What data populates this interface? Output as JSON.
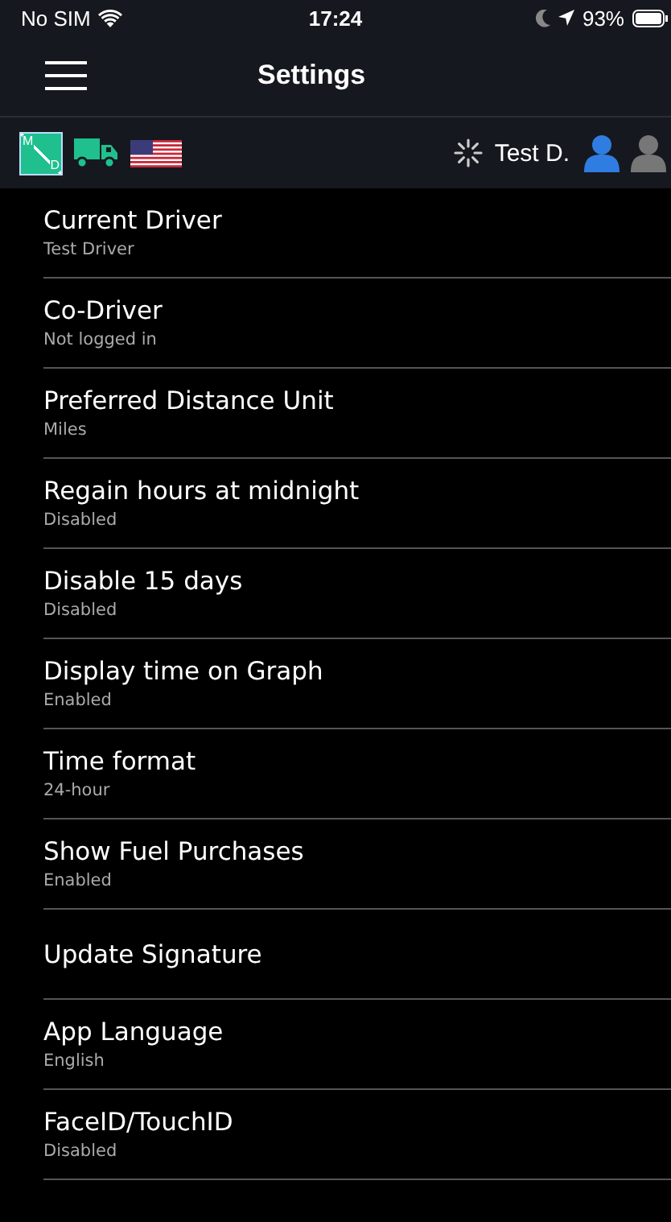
{
  "status_bar": {
    "carrier": "No SIM",
    "time": "17:24",
    "battery": "93%"
  },
  "nav": {
    "title": "Settings"
  },
  "toolbar": {
    "mode_badge": {
      "top": "M",
      "bottom": "D"
    },
    "driver_name": "Test D.",
    "drivers": [
      {
        "active": true
      },
      {
        "active": false
      }
    ]
  },
  "settings": [
    {
      "title": "Current Driver",
      "value": "Test Driver"
    },
    {
      "title": "Co-Driver",
      "value": "Not logged in"
    },
    {
      "title": "Preferred Distance Unit",
      "value": "Miles"
    },
    {
      "title": "Regain hours at midnight",
      "value": "Disabled"
    },
    {
      "title": "Disable 15 days",
      "value": "Disabled"
    },
    {
      "title": "Display time on Graph",
      "value": "Enabled"
    },
    {
      "title": "Time format",
      "value": "24-hour"
    },
    {
      "title": "Show Fuel Purchases",
      "value": "Enabled"
    },
    {
      "title": "Update Signature"
    },
    {
      "title": "App Language",
      "value": "English"
    },
    {
      "title": "FaceID/TouchID",
      "value": "Disabled"
    }
  ]
}
